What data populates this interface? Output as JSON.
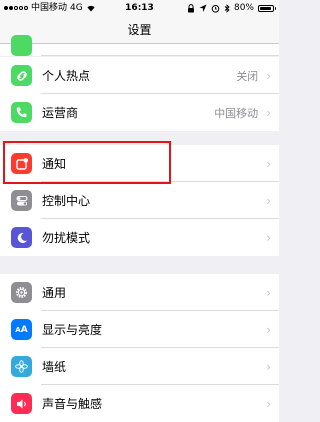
{
  "status_bar": {
    "carrier": "中国移动",
    "network": "4G",
    "time": "16:13",
    "battery": "80%"
  },
  "nav": {
    "title": "设置"
  },
  "rows": [
    {
      "label": "个人热点",
      "value": "关闭",
      "icon": "hotspot-icon",
      "color": "#4cd964"
    },
    {
      "label": "运营商",
      "value": "中国移动",
      "icon": "phone-icon",
      "color": "#4cd964"
    },
    {
      "label": "通知",
      "icon": "notification-icon",
      "color": "#ff3b30"
    },
    {
      "label": "控制中心",
      "icon": "control-center-icon",
      "color": "#8e8e93"
    },
    {
      "label": "勿扰模式",
      "icon": "moon-icon",
      "color": "#5856d6"
    },
    {
      "label": "通用",
      "icon": "gear-icon",
      "color": "#8e8e93"
    },
    {
      "label": "显示与亮度",
      "icon": "display-icon",
      "color": "#007aff"
    },
    {
      "label": "墙纸",
      "icon": "wallpaper-icon",
      "color": "#34aadc"
    },
    {
      "label": "声音与触感",
      "icon": "sound-icon",
      "color": "#ff2d55"
    }
  ],
  "chevron": "›"
}
